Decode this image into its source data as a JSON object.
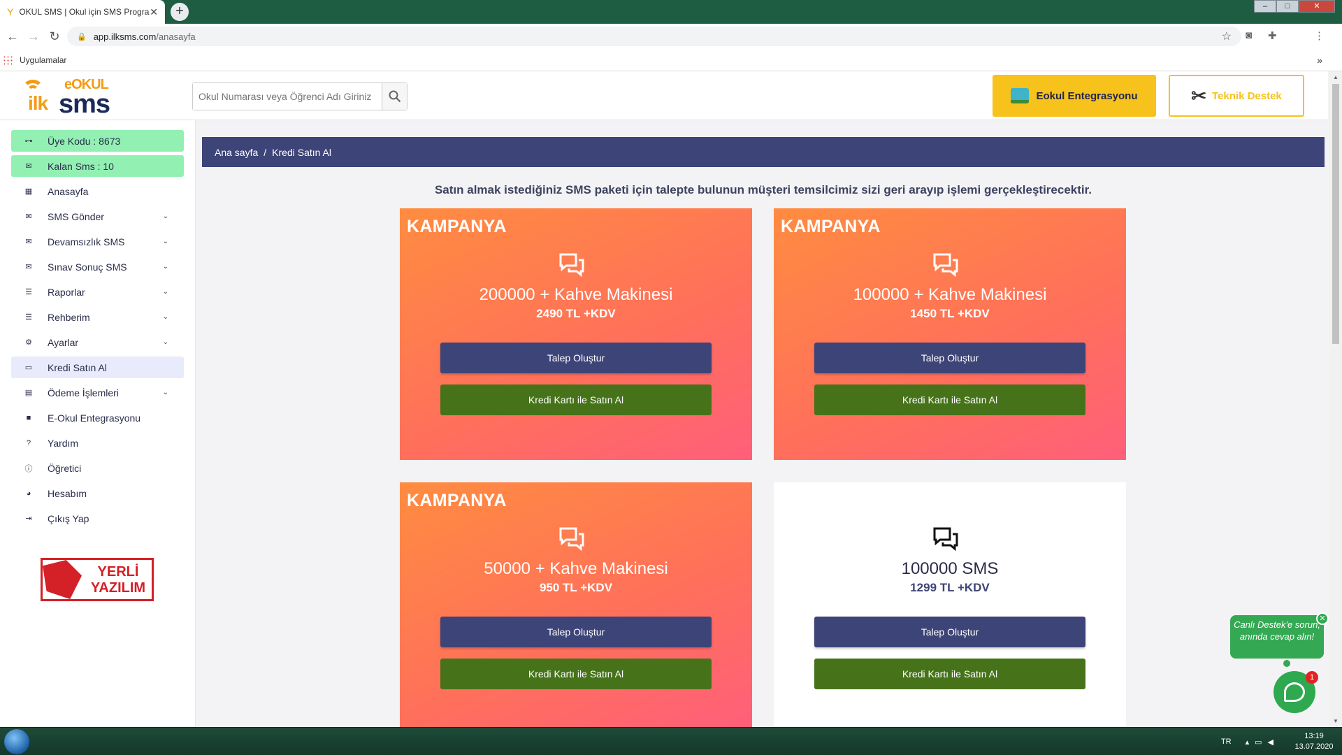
{
  "browser": {
    "tab_title": "OKUL SMS | Okul için SMS Programı",
    "tab_close": "✕",
    "new_tab": "+",
    "url_domain": "app.ilksms.com",
    "url_path": "/anasayfa",
    "bookmarks_label": "Uygulamalar",
    "bookmarks_more": "»"
  },
  "header": {
    "logo_e_okul": "eOKUL",
    "logo_ilk": "ilk",
    "logo_sms": "sms",
    "search_placeholder": "Okul Numarası veya Öğrenci Adı Giriniz",
    "eokul_button": "Eokul Entegrasyonu",
    "destek_button": "Teknik Destek"
  },
  "sidebar": {
    "items": [
      {
        "label": "Üye Kodu : 8673",
        "icon": "key-icon"
      },
      {
        "label": "Kalan Sms : 10",
        "icon": "mail-icon"
      },
      {
        "label": "Anasayfa",
        "icon": "grid-icon"
      },
      {
        "label": "SMS Gönder",
        "icon": "mail-icon"
      },
      {
        "label": "Devamsızlık SMS",
        "icon": "mail-icon"
      },
      {
        "label": "Sınav Sonuç SMS",
        "icon": "mail-icon"
      },
      {
        "label": "Raporlar",
        "icon": "list-icon"
      },
      {
        "label": "Rehberim",
        "icon": "list-icon"
      },
      {
        "label": "Ayarlar",
        "icon": "gear-icon"
      },
      {
        "label": "Kredi Satın Al",
        "icon": "money-icon"
      },
      {
        "label": "Ödeme İşlemleri",
        "icon": "card-icon"
      },
      {
        "label": "E-Okul Entegrasyonu",
        "icon": "folder-icon"
      },
      {
        "label": "Yardım",
        "icon": "help-icon"
      },
      {
        "label": "Öğretici",
        "icon": "info-icon"
      },
      {
        "label": "Hesabım",
        "icon": "user-icon"
      },
      {
        "label": "Çıkış Yap",
        "icon": "logout-icon"
      }
    ],
    "badge_line1": "YERLİ",
    "badge_line2": "YAZILIM"
  },
  "main": {
    "breadcrumb_home": "Ana sayfa",
    "breadcrumb_sep": "/",
    "breadcrumb_current": "Kredi Satın Al",
    "notice": "Satın almak istediğiniz SMS paketi için talepte bulunun müşteri temsilcimiz sizi geri arayıp işlemi gerçekleştirecektir.",
    "cards": [
      {
        "tag": "KAMPANYA",
        "name": "200000 + Kahve Makinesi",
        "price": "2490 TL +KDV",
        "talep": "Talep Oluştur",
        "kredi": "Kredi Kartı ile Satın Al"
      },
      {
        "tag": "KAMPANYA",
        "name": "100000 + Kahve Makinesi",
        "price": "1450 TL +KDV",
        "talep": "Talep Oluştur",
        "kredi": "Kredi Kartı ile Satın Al"
      },
      {
        "tag": "KAMPANYA",
        "name": "50000 + Kahve Makinesi",
        "price": "950 TL +KDV",
        "talep": "Talep Oluştur",
        "kredi": "Kredi Kartı ile Satın Al"
      },
      {
        "tag": "",
        "name": "100000 SMS",
        "price": "1299 TL +KDV",
        "talep": "Talep Oluştur",
        "kredi": "Kredi Kartı ile Satın Al"
      }
    ]
  },
  "chat": {
    "bubble": "Canlı Destek'e sorun, anında cevap alın!",
    "close": "✕",
    "badge": "1"
  },
  "taskbar": {
    "lang": "TR",
    "time": "13:19",
    "date": "13.07.2020"
  },
  "colors": {
    "brand_orange": "#f39c12",
    "brand_navy": "#3d4478",
    "buy_green": "#46731a",
    "yellow": "#f7c21b",
    "mint": "#93f0b3"
  }
}
